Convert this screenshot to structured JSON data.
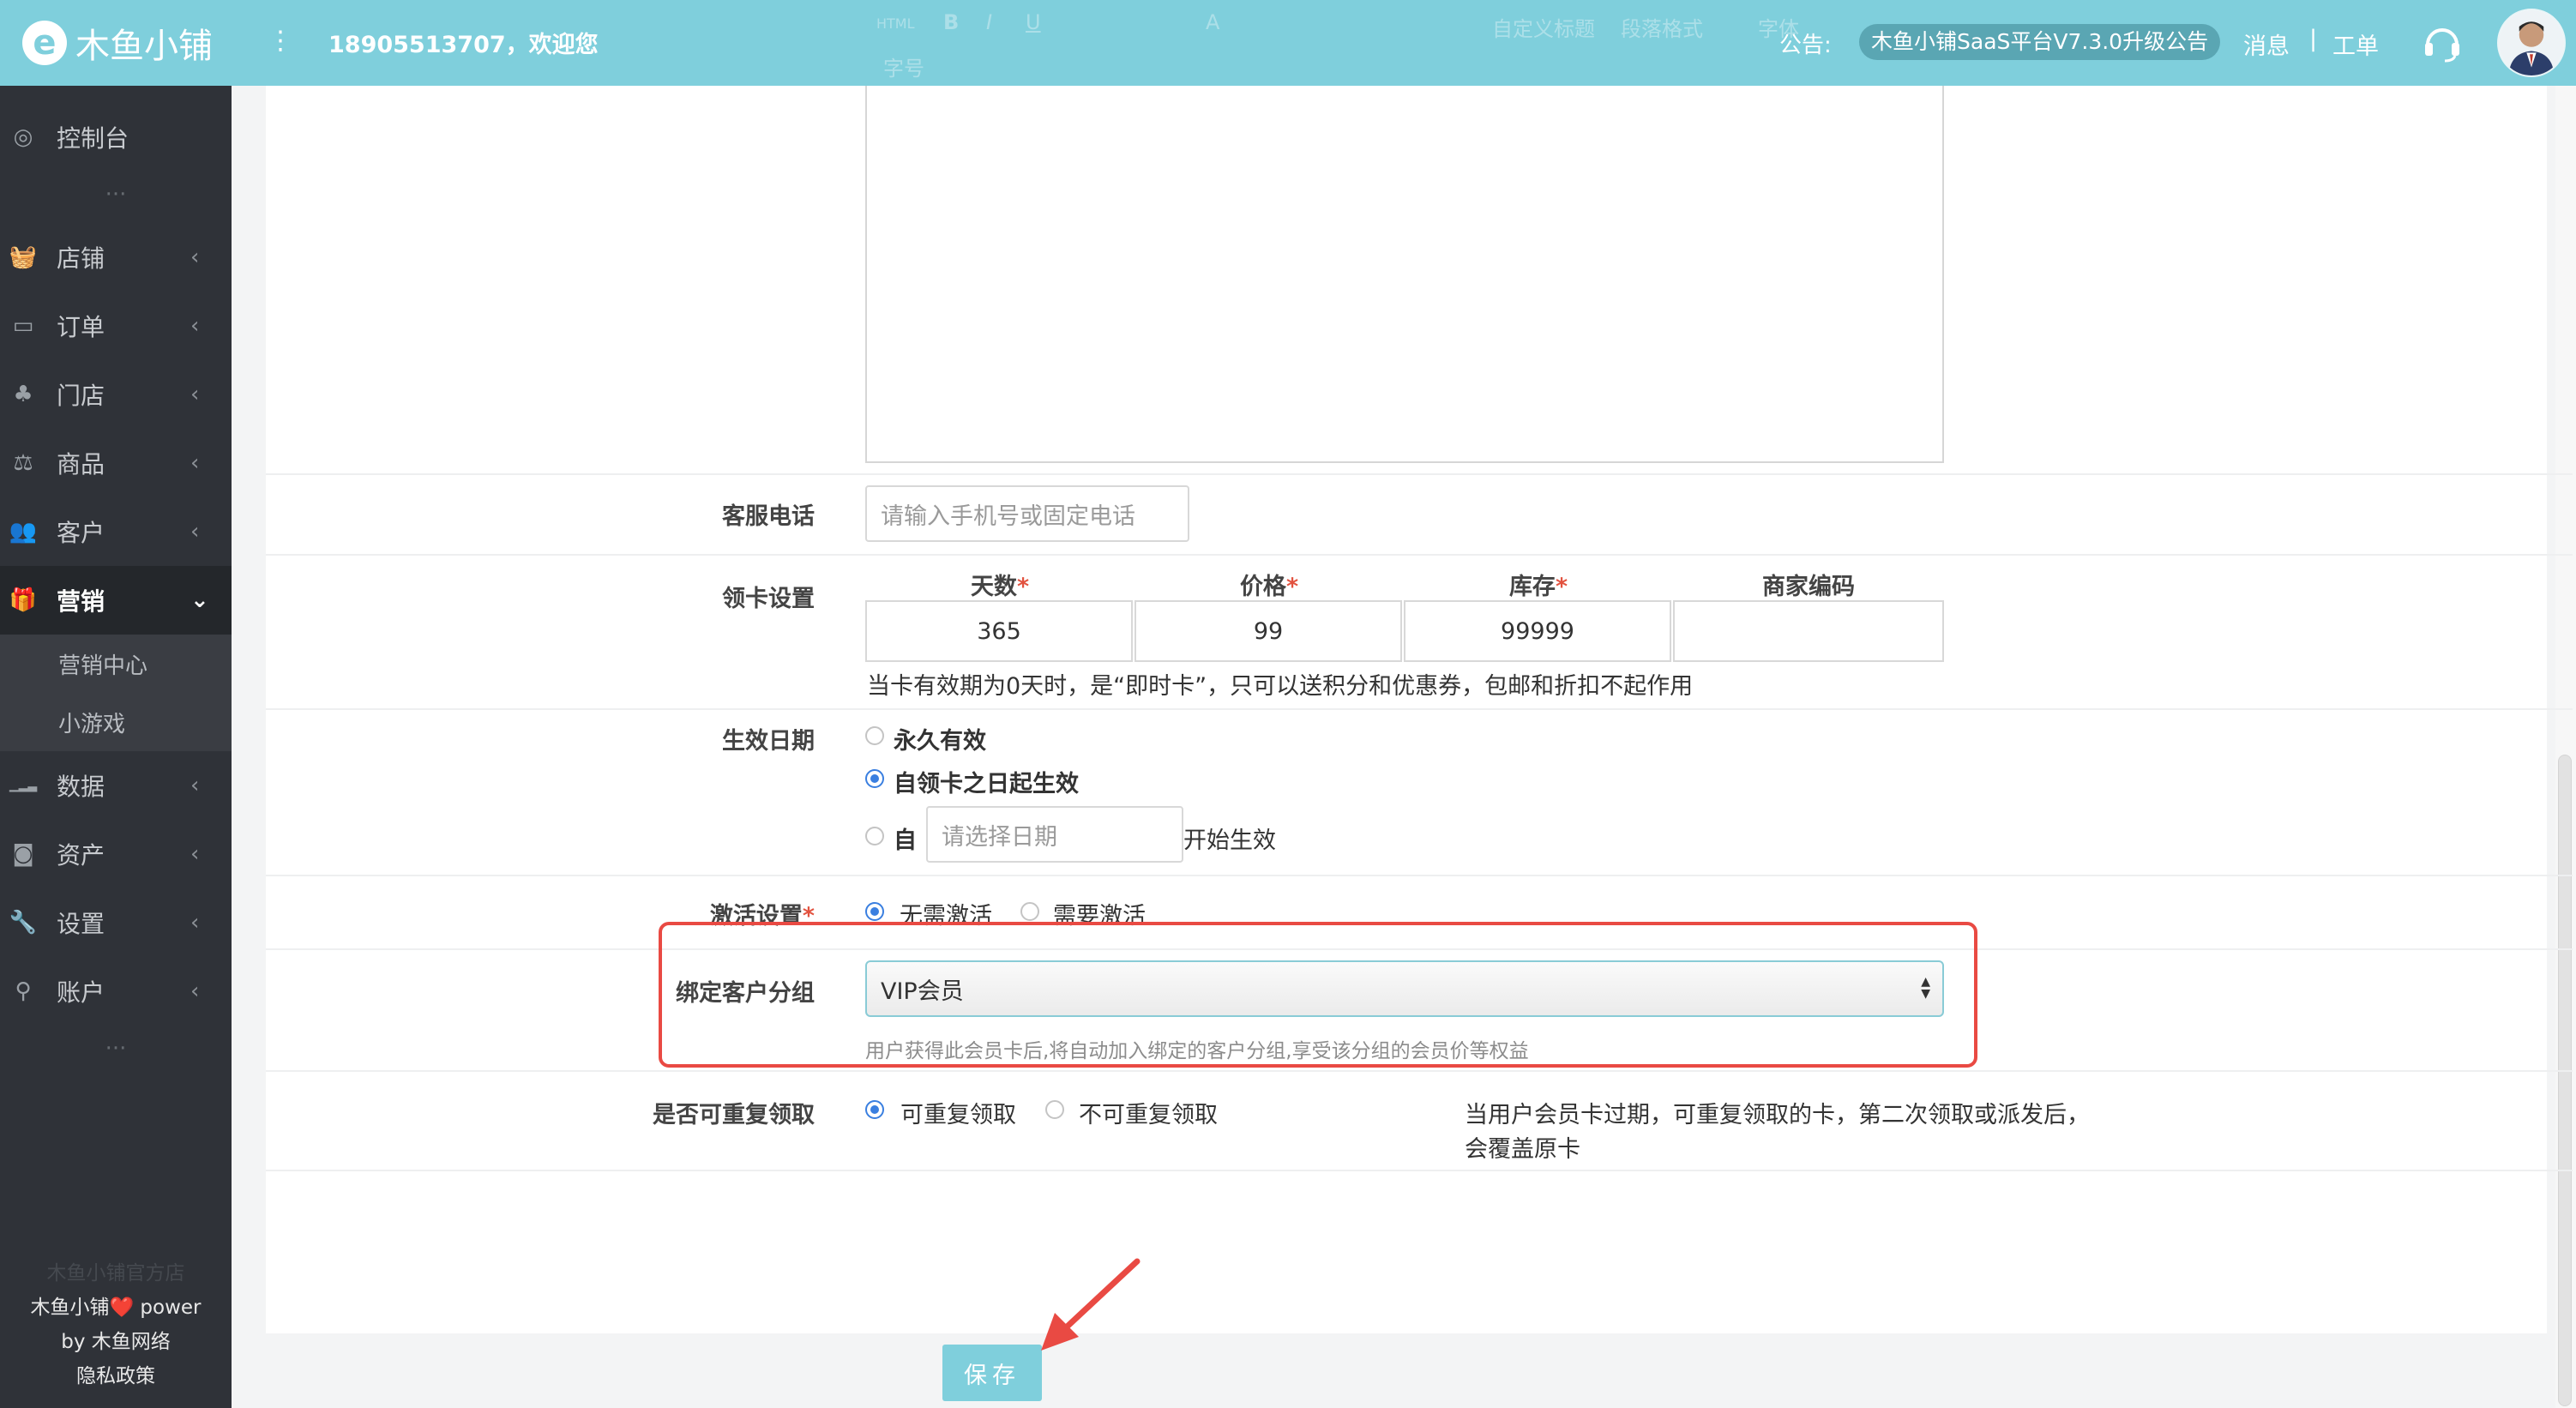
{
  "header": {
    "logo_letter": "e",
    "logo_text": "木鱼小铺",
    "menu_icon": "⋮",
    "welcome": "18905513707，欢迎您",
    "notice_label": "公告:",
    "notice_text": "木鱼小铺SaaS平台V7.3.0升级公告",
    "messages": "消息",
    "separator": "|",
    "tickets": "工单",
    "toolbar_ghost": {
      "html": "HTML",
      "bold": "B",
      "italic": "I",
      "underline": "U",
      "font_color": "A",
      "custom_title": "自定义标题",
      "para_format": "段落格式",
      "font_family": "字体",
      "font_size": "字号"
    }
  },
  "sidebar": {
    "items": [
      {
        "label": "控制台",
        "icon": "dashboard-icon",
        "glyph": "◎",
        "chevron": ""
      },
      {
        "label": "店铺",
        "icon": "shop-basket-icon",
        "glyph": "🧺",
        "chevron": "‹"
      },
      {
        "label": "订单",
        "icon": "order-icon",
        "glyph": "▭",
        "chevron": "‹"
      },
      {
        "label": "门店",
        "icon": "store-sitemap-icon",
        "glyph": "♣",
        "chevron": "‹"
      },
      {
        "label": "商品",
        "icon": "balance-scale-icon",
        "glyph": "⚖",
        "chevron": "‹"
      },
      {
        "label": "客户",
        "icon": "users-icon",
        "glyph": "👥",
        "chevron": "‹"
      },
      {
        "label": "营销",
        "icon": "gift-icon",
        "glyph": "🎁",
        "chevron": "⌄"
      },
      {
        "label": "数据",
        "icon": "signal-bars-icon",
        "glyph": "▁▂▃",
        "chevron": "‹"
      },
      {
        "label": "资产",
        "icon": "money-icon",
        "glyph": "◙",
        "chevron": "‹"
      },
      {
        "label": "设置",
        "icon": "wrench-icon",
        "glyph": "🔧",
        "chevron": "‹"
      },
      {
        "label": "账户",
        "icon": "key-icon",
        "glyph": "⚲",
        "chevron": "‹"
      }
    ],
    "submenu": [
      "营销中心",
      "小游戏"
    ],
    "dots": "···",
    "footer": {
      "shop": "木鱼小铺官方店",
      "power": "木鱼小铺❤️ power",
      "by": "by 木鱼网络",
      "privacy": "隐私政策"
    }
  },
  "form": {
    "service_phone": {
      "label": "客服电话",
      "placeholder": "请输入手机号或固定电话"
    },
    "card_settings": {
      "label": "领卡设置",
      "columns": [
        {
          "title": "天数",
          "required": "*"
        },
        {
          "title": "价格",
          "required": "*"
        },
        {
          "title": "库存",
          "required": "*"
        },
        {
          "title": "商家编码",
          "required": ""
        }
      ],
      "values": [
        "365",
        "99",
        "99999",
        ""
      ],
      "note": "当卡有效期为0天时，是“即时卡”，只可以送积分和优惠券，包邮和折扣不起作用"
    },
    "effective_date": {
      "label": "生效日期",
      "options": [
        "永久有效",
        "自领卡之日起生效"
      ],
      "from": "自",
      "date_placeholder": "请选择日期",
      "start_text": "开始生效",
      "selected": "自领卡之日起生效"
    },
    "activation": {
      "label": "激活设置",
      "required": "*",
      "options": [
        "无需激活",
        "需要激活"
      ],
      "selected": "无需激活"
    },
    "customer_group": {
      "label": "绑定客户分组",
      "value": "VIP会员",
      "help": "用户获得此会员卡后,将自动加入绑定的客户分组,享受该分组的会员价等权益"
    },
    "repeat": {
      "label": "是否可重复领取",
      "options": [
        "可重复领取",
        "不可重复领取"
      ],
      "selected": "可重复领取",
      "note_line1": "当用户会员卡过期，可重复领取的卡，第二次领取或派发后，",
      "note_line2": "会覆盖原卡"
    },
    "save": "保存"
  },
  "colors": {
    "brand": "#7fcfdc",
    "highlight": "#e94a43",
    "radio": "#3a7fe0",
    "sidebar": "#2f3238"
  }
}
